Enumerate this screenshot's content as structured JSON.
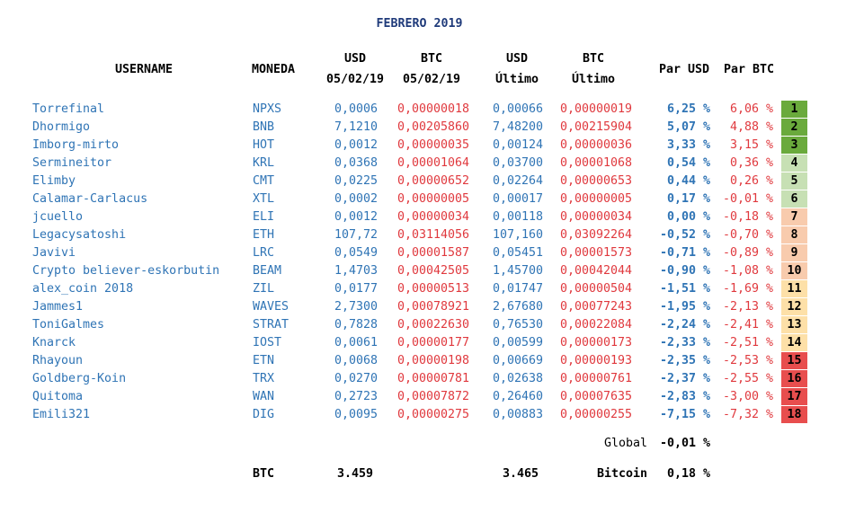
{
  "title": "FEBRERO 2019",
  "headers": {
    "username": "USERNAME",
    "moneda": "MONEDA",
    "usd_date_1": "USD",
    "usd_date_2": "05/02/19",
    "btc_date_1": "BTC",
    "btc_date_2": "05/02/19",
    "usd_last_1": "USD",
    "usd_last_2": "Último",
    "btc_last_1": "BTC",
    "btc_last_2": "Último",
    "par_usd": "Par USD",
    "par_btc": "Par BTC"
  },
  "rows": [
    {
      "username": "Torrefinal",
      "coin": "NPXS",
      "usd_start": "0,0006",
      "btc_start": "0,00000018",
      "usd_last": "0,00066",
      "btc_last": "0,00000019",
      "par_usd": "6,25 %",
      "par_btc": "6,06 %",
      "rank": "1"
    },
    {
      "username": "Dhormigo",
      "coin": "BNB",
      "usd_start": "7,1210",
      "btc_start": "0,00205860",
      "usd_last": "7,48200",
      "btc_last": "0,00215904",
      "par_usd": "5,07 %",
      "par_btc": "4,88 %",
      "rank": "2"
    },
    {
      "username": "Imborg-mirto",
      "coin": "HOT",
      "usd_start": "0,0012",
      "btc_start": "0,00000035",
      "usd_last": "0,00124",
      "btc_last": "0,00000036",
      "par_usd": "3,33 %",
      "par_btc": "3,15 %",
      "rank": "3"
    },
    {
      "username": "Sermineitor",
      "coin": "KRL",
      "usd_start": "0,0368",
      "btc_start": "0,00001064",
      "usd_last": "0,03700",
      "btc_last": "0,00001068",
      "par_usd": "0,54 %",
      "par_btc": "0,36 %",
      "rank": "4"
    },
    {
      "username": "Elimby",
      "coin": "CMT",
      "usd_start": "0,0225",
      "btc_start": "0,00000652",
      "usd_last": "0,02264",
      "btc_last": "0,00000653",
      "par_usd": "0,44 %",
      "par_btc": "0,26 %",
      "rank": "5"
    },
    {
      "username": "Calamar-Carlacus",
      "coin": "XTL",
      "usd_start": "0,0002",
      "btc_start": "0,00000005",
      "usd_last": "0,00017",
      "btc_last": "0,00000005",
      "par_usd": "0,17 %",
      "par_btc": "-0,01 %",
      "rank": "6"
    },
    {
      "username": "jcuello",
      "coin": "ELI",
      "usd_start": "0,0012",
      "btc_start": "0,00000034",
      "usd_last": "0,00118",
      "btc_last": "0,00000034",
      "par_usd": "0,00 %",
      "par_btc": "-0,18 %",
      "rank": "7"
    },
    {
      "username": "Legacysatoshi",
      "coin": "ETH",
      "usd_start": "107,72",
      "btc_start": "0,03114056",
      "usd_last": "107,160",
      "btc_last": "0,03092264",
      "par_usd": "-0,52 %",
      "par_btc": "-0,70 %",
      "rank": "8"
    },
    {
      "username": "Javivi",
      "coin": "LRC",
      "usd_start": "0,0549",
      "btc_start": "0,00001587",
      "usd_last": "0,05451",
      "btc_last": "0,00001573",
      "par_usd": "-0,71 %",
      "par_btc": "-0,89 %",
      "rank": "9"
    },
    {
      "username": "Crypto believer-eskorbutin",
      "coin": "BEAM",
      "usd_start": "1,4703",
      "btc_start": "0,00042505",
      "usd_last": "1,45700",
      "btc_last": "0,00042044",
      "par_usd": "-0,90 %",
      "par_btc": "-1,08 %",
      "rank": "10"
    },
    {
      "username": "alex_coin 2018",
      "coin": "ZIL",
      "usd_start": "0,0177",
      "btc_start": "0,00000513",
      "usd_last": "0,01747",
      "btc_last": "0,00000504",
      "par_usd": "-1,51 %",
      "par_btc": "-1,69 %",
      "rank": "11"
    },
    {
      "username": "Jammes1",
      "coin": "WAVES",
      "usd_start": "2,7300",
      "btc_start": "0,00078921",
      "usd_last": "2,67680",
      "btc_last": "0,00077243",
      "par_usd": "-1,95 %",
      "par_btc": "-2,13 %",
      "rank": "12"
    },
    {
      "username": "ToniGalmes",
      "coin": "STRAT",
      "usd_start": "0,7828",
      "btc_start": "0,00022630",
      "usd_last": "0,76530",
      "btc_last": "0,00022084",
      "par_usd": "-2,24 %",
      "par_btc": "-2,41 %",
      "rank": "13"
    },
    {
      "username": "Knarck",
      "coin": "IOST",
      "usd_start": "0,0061",
      "btc_start": "0,00000177",
      "usd_last": "0,00599",
      "btc_last": "0,00000173",
      "par_usd": "-2,33 %",
      "par_btc": "-2,51 %",
      "rank": "14"
    },
    {
      "username": "Rhayoun",
      "coin": "ETN",
      "usd_start": "0,0068",
      "btc_start": "0,00000198",
      "usd_last": "0,00669",
      "btc_last": "0,00000193",
      "par_usd": "-2,35 %",
      "par_btc": "-2,53 %",
      "rank": "15"
    },
    {
      "username": "Goldberg-Koin",
      "coin": "TRX",
      "usd_start": "0,0270",
      "btc_start": "0,00000781",
      "usd_last": "0,02638",
      "btc_last": "0,00000761",
      "par_usd": "-2,37 %",
      "par_btc": "-2,55 %",
      "rank": "16"
    },
    {
      "username": "Quitoma",
      "coin": "WAN",
      "usd_start": "0,2723",
      "btc_start": "0,00007872",
      "usd_last": "0,26460",
      "btc_last": "0,00007635",
      "par_usd": "-2,83 %",
      "par_btc": "-3,00 %",
      "rank": "17"
    },
    {
      "username": "Emili321",
      "coin": "DIG",
      "usd_start": "0,0095",
      "btc_start": "0,00000275",
      "usd_last": "0,00883",
      "btc_last": "0,00000255",
      "par_usd": "-7,15 %",
      "par_btc": "-7,32 %",
      "rank": "18"
    }
  ],
  "rank_colors": [
    "#6aaa3c",
    "#6aaa3c",
    "#6aaa3c",
    "#c7e0b4",
    "#c7e0b4",
    "#c7e0b4",
    "#f8cbad",
    "#f8cbad",
    "#f8cbad",
    "#f8cbad",
    "#fde0a8",
    "#fde0a8",
    "#fde0a8",
    "#fde0a8",
    "#e84e4e",
    "#e84e4e",
    "#e84e4e",
    "#e84e4e"
  ],
  "footer": {
    "global_label": "Global",
    "global_value": "-0,01 %",
    "btc_label": "BTC",
    "btc_usd_start": "3.459",
    "btc_usd_last": "3.465",
    "bitcoin_label": "Bitcoin",
    "bitcoin_value": "0,18 %"
  }
}
